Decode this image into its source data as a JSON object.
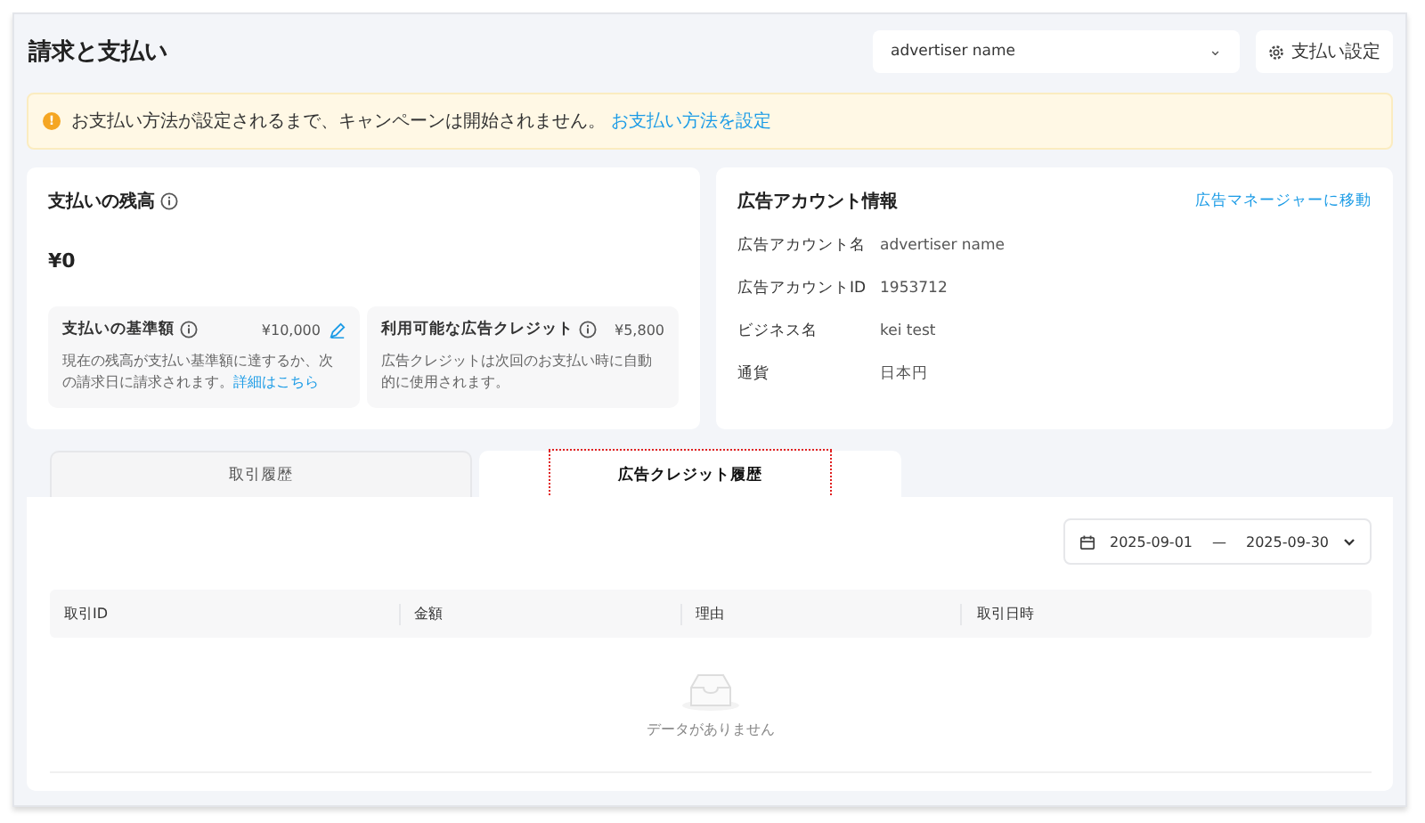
{
  "page": {
    "title": "請求と支払い"
  },
  "header": {
    "account_select": {
      "value": "advertiser name",
      "caret": "⌄"
    },
    "settings_button": {
      "label": "支払い設定"
    }
  },
  "alert": {
    "icon": "!",
    "message": "お支払い方法が設定されるまで、キャンペーンは開始されません。",
    "link": "お支払い方法を設定"
  },
  "balance_card": {
    "title": "支払いの残高",
    "amount": "¥0",
    "tiles": [
      {
        "title": "支払いの基準額",
        "value": "¥10,000",
        "editable": true,
        "description": "現在の残高が支払い基準額に達するか、次の請求日に請求されます。",
        "link": "詳細はこちら"
      },
      {
        "title": "利用可能な広告クレジット",
        "value": "¥5,800",
        "editable": false,
        "description": "広告クレジットは次回のお支払い時に自動的に使用されます。"
      }
    ]
  },
  "account_card": {
    "title": "広告アカウント情報",
    "link": "広告マネージャーに移動",
    "fields": [
      {
        "label": "広告アカウント名",
        "value": "advertiser name"
      },
      {
        "label": "広告アカウントID",
        "value": "1953712"
      },
      {
        "label": "ビジネス名",
        "value": "kei test"
      },
      {
        "label": "通貨",
        "value": "日本円"
      }
    ]
  },
  "tabs": [
    {
      "label": "取引履歴",
      "selected": false,
      "highlighted": false
    },
    {
      "label": "広告クレジット履歴",
      "selected": true,
      "highlighted": true
    }
  ],
  "date_range": {
    "start": "2025-09-01",
    "separator": "—",
    "end": "2025-09-30"
  },
  "table": {
    "columns": [
      "取引ID",
      "金額",
      "理由",
      "取引日時"
    ],
    "empty_text": "データがありません"
  }
}
